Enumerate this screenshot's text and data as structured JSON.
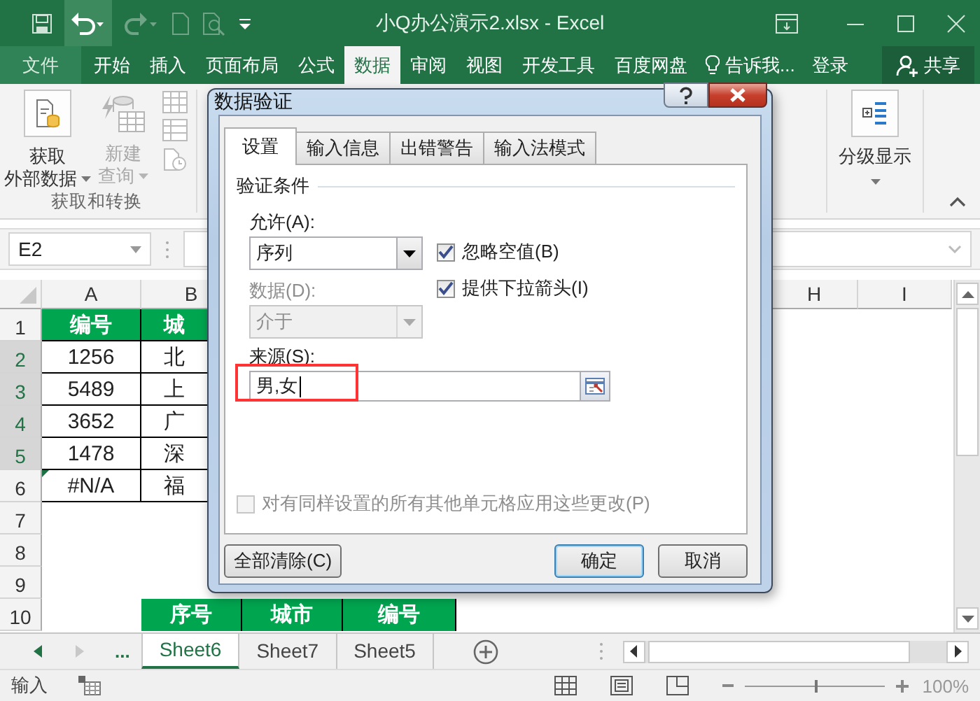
{
  "window": {
    "title": "小Q办公演示2.xlsx - Excel"
  },
  "ribbon_tabs": [
    {
      "label": "文件",
      "kind": "file",
      "selected": false
    },
    {
      "label": "开始",
      "kind": "tab",
      "selected": false
    },
    {
      "label": "插入",
      "kind": "tab",
      "selected": false
    },
    {
      "label": "页面布局",
      "kind": "tab",
      "selected": false
    },
    {
      "label": "公式",
      "kind": "tab",
      "selected": false
    },
    {
      "label": "数据",
      "kind": "tab",
      "selected": true
    },
    {
      "label": "审阅",
      "kind": "tab",
      "selected": false
    },
    {
      "label": "视图",
      "kind": "tab",
      "selected": false
    },
    {
      "label": "开发工具",
      "kind": "tab",
      "selected": false
    },
    {
      "label": "百度网盘",
      "kind": "tab",
      "selected": false
    }
  ],
  "tell_me": "告诉我...",
  "sign_in": "登录",
  "share": "共享",
  "ribbon": {
    "buttons": [
      {
        "lines": [
          "获取",
          "外部数据"
        ],
        "disabled": false
      },
      {
        "lines": [
          "新建",
          "查询"
        ],
        "disabled": true
      }
    ],
    "group_label": "获取和转换",
    "outline_button": {
      "label": "分级显示"
    }
  },
  "formula_bar": {
    "name_box": "E2"
  },
  "sheet": {
    "columns": [
      {
        "label": "A"
      },
      {
        "label": "B"
      },
      {
        "label": "H"
      },
      {
        "label": "I"
      }
    ],
    "rows": [
      {
        "number": "1",
        "selected": false,
        "cells": [
          {
            "text": "编号",
            "kind": "header"
          },
          {
            "text": "城",
            "kind": "header"
          }
        ]
      },
      {
        "number": "2",
        "selected": true,
        "cells": [
          {
            "text": "1256",
            "kind": "data"
          },
          {
            "text": "北",
            "kind": "data"
          }
        ]
      },
      {
        "number": "3",
        "selected": true,
        "cells": [
          {
            "text": "5489",
            "kind": "data"
          },
          {
            "text": "上",
            "kind": "data"
          }
        ]
      },
      {
        "number": "4",
        "selected": true,
        "cells": [
          {
            "text": "3652",
            "kind": "data"
          },
          {
            "text": "广",
            "kind": "data"
          }
        ]
      },
      {
        "number": "5",
        "selected": true,
        "cells": [
          {
            "text": "1478",
            "kind": "data"
          },
          {
            "text": "深",
            "kind": "data"
          }
        ]
      },
      {
        "number": "6",
        "selected": false,
        "cells": [
          {
            "text": "#N/A",
            "kind": "error"
          },
          {
            "text": "福",
            "kind": "data"
          }
        ]
      },
      {
        "number": "7",
        "selected": false
      },
      {
        "number": "8",
        "selected": false
      },
      {
        "number": "9",
        "selected": false
      },
      {
        "number": "10",
        "selected": false
      }
    ],
    "table_2": {
      "headers": [
        "序号",
        "城市",
        "编号"
      ]
    }
  },
  "sheet_tabs": [
    {
      "label": "Sheet6",
      "selected": true
    },
    {
      "label": "Sheet7",
      "selected": false
    },
    {
      "label": "Sheet5",
      "selected": false
    }
  ],
  "sheet_nav_more": "...",
  "status_bar": {
    "mode": "输入",
    "zoom": {
      "level": 0.5,
      "reading": "100%"
    }
  },
  "dialog": {
    "title": "数据验证",
    "tabs": [
      {
        "label": "设置",
        "selected": true
      },
      {
        "label": "输入信息",
        "selected": false
      },
      {
        "label": "出错警告",
        "selected": false
      },
      {
        "label": "输入法模式",
        "selected": false
      }
    ],
    "section": "验证条件",
    "allow_label": "允许(A):",
    "allow_value": "序列",
    "checkboxes": [
      {
        "label": "忽略空值(B)",
        "checked": true
      },
      {
        "label": "提供下拉箭头(I)",
        "checked": true
      }
    ],
    "data_label": "数据(D):",
    "data_value": "介于",
    "data_disabled": true,
    "source_label": "来源(S):",
    "source_value": "男,女",
    "source_highlighted": true,
    "apply_all": {
      "label": "对有同样设置的所有其他单元格应用这些更改(P)",
      "checked": false,
      "disabled": true
    },
    "buttons": [
      {
        "label": "全部清除(C)",
        "kind": "clear",
        "default": false
      },
      {
        "label": "确定",
        "kind": "ok",
        "default": true
      },
      {
        "label": "取消",
        "kind": "cancel",
        "default": false
      }
    ]
  }
}
